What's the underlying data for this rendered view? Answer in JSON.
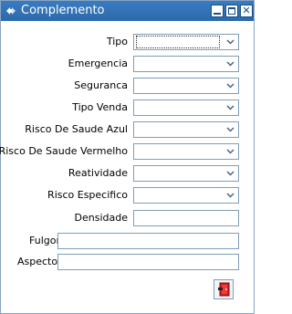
{
  "window": {
    "title": "Complemento"
  },
  "fields": {
    "tipo": {
      "label": "Tipo",
      "value": ""
    },
    "emergencia": {
      "label": "Emergencia",
      "value": ""
    },
    "seguranca": {
      "label": "Seguranca",
      "value": ""
    },
    "tipo_venda": {
      "label": "Tipo Venda",
      "value": ""
    },
    "risco_saude_azul": {
      "label": "Risco De Saude Azul",
      "value": ""
    },
    "risco_saude_vermelho": {
      "label": "Risco De Saude Vermelho",
      "value": ""
    },
    "reatividade": {
      "label": "Reatividade",
      "value": ""
    },
    "risco_especifico": {
      "label": "Risco Especifico",
      "value": ""
    },
    "densidade": {
      "label": "Densidade",
      "value": ""
    },
    "fulgor": {
      "label": "Fulgor",
      "value": ""
    },
    "aspecto": {
      "label": "Aspecto",
      "value": ""
    }
  },
  "icons": {
    "title": "window-app-icon",
    "dropdown": "chevron-down-icon",
    "exit": "exit-door-icon"
  },
  "colors": {
    "titlebar": "#2b6aab",
    "border": "#7f9db9",
    "exit_door": "#d3201f"
  }
}
